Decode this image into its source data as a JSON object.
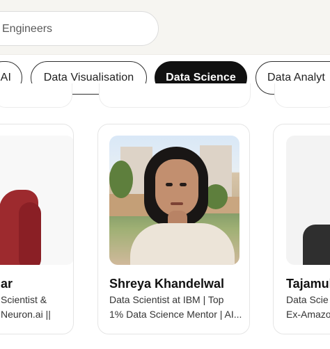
{
  "search": {
    "placeholder": "Engineers"
  },
  "filters": [
    {
      "label": "AI",
      "active": false
    },
    {
      "label": "Data Visualisation",
      "active": false
    },
    {
      "label": "Data Science",
      "active": true
    },
    {
      "label": "Data Analyt",
      "active": false
    }
  ],
  "cards": [
    {
      "name": "ar",
      "role_lines": [
        "Scientist &",
        "Neuron.ai ||"
      ]
    },
    {
      "name": "Shreya Khandelwal",
      "role_lines": [
        "Data Scientist at IBM | Top",
        "1% Data Science Mentor | AI..."
      ]
    },
    {
      "name": "Tajamul",
      "role_lines": [
        "Data Scie",
        "Ex-Amazo"
      ]
    }
  ],
  "colors": {
    "active_chip": "#111111",
    "chip_border": "#2f2f2f",
    "background": "#ffffff",
    "search_band": "#f6f5f1"
  }
}
